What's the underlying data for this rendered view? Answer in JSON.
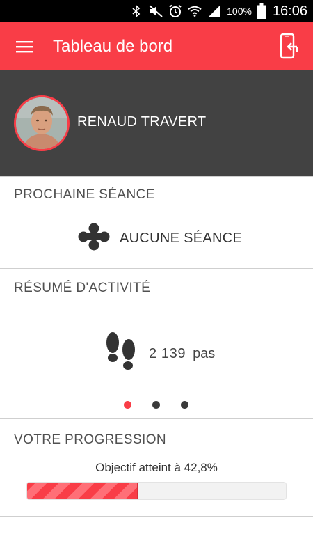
{
  "status_bar": {
    "battery_text": "100%",
    "time": "16:06",
    "icons": [
      "bluetooth-icon",
      "mute-icon",
      "alarm-icon",
      "wifi-icon",
      "signal-icon",
      "battery-icon"
    ]
  },
  "app_bar": {
    "title": "Tableau de bord",
    "menu_icon": "hamburger-menu-icon",
    "action_icon": "phone-switch-icon",
    "color": "#f93d47"
  },
  "profile": {
    "name": "RENAUD TRAVERT",
    "background": "#424242"
  },
  "next_session": {
    "title": "PROCHAINE SÉANCE",
    "label": "AUCUNE SÉANCE",
    "icon": "session-logo-icon"
  },
  "activity": {
    "title": "RÉSUMÉ D'ACTIVITÉ",
    "value": "2 139",
    "unit": "pas",
    "icon": "footsteps-icon",
    "pages": 3,
    "active_page": 0
  },
  "progress": {
    "title": "VOTRE PROGRESSION",
    "objective_text": "Objectif atteint à 42,8%",
    "percent": 42.8
  }
}
